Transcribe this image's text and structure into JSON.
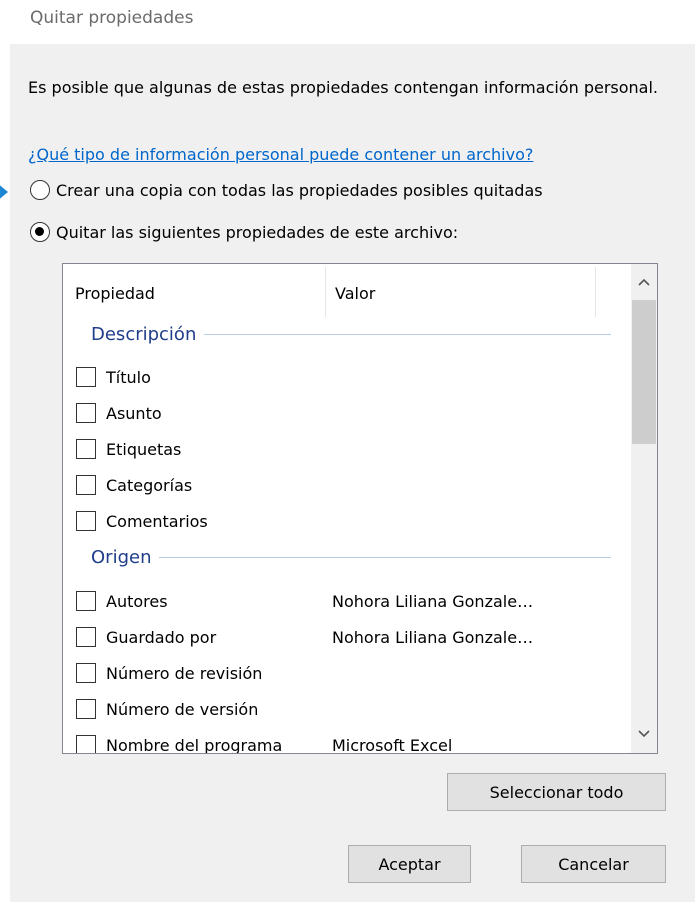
{
  "dialog": {
    "title": "Quitar propiedades",
    "description": "Es posible que algunas de estas propiedades contengan información personal.",
    "help_link": "¿Qué tipo de información personal puede contener un archivo?",
    "option_copy": "Crear una copia con todas las propiedades posibles quitadas",
    "option_remove": "Quitar las siguientes propiedades de este archivo:",
    "selected_option": "option_remove"
  },
  "list": {
    "columns": [
      "Propiedad",
      "Valor"
    ],
    "groups": [
      {
        "label": "Descripción",
        "rows": [
          {
            "name": "Título",
            "value": ""
          },
          {
            "name": "Asunto",
            "value": ""
          },
          {
            "name": "Etiquetas",
            "value": ""
          },
          {
            "name": "Categorías",
            "value": ""
          },
          {
            "name": "Comentarios",
            "value": ""
          }
        ]
      },
      {
        "label": "Origen",
        "rows": [
          {
            "name": "Autores",
            "value": "Nohora Liliana Gonzale…"
          },
          {
            "name": "Guardado por",
            "value": "Nohora Liliana Gonzale…"
          },
          {
            "name": "Número de revisión",
            "value": ""
          },
          {
            "name": "Número de versión",
            "value": ""
          },
          {
            "name": "Nombre del programa",
            "value": "Microsoft Excel"
          }
        ]
      }
    ]
  },
  "buttons": {
    "select_all": "Seleccionar todo",
    "ok": "Aceptar",
    "cancel": "Cancelar"
  },
  "colors": {
    "link": "#0066cc",
    "group_label": "#1f3d8a",
    "pointer": "#1e88d4"
  }
}
